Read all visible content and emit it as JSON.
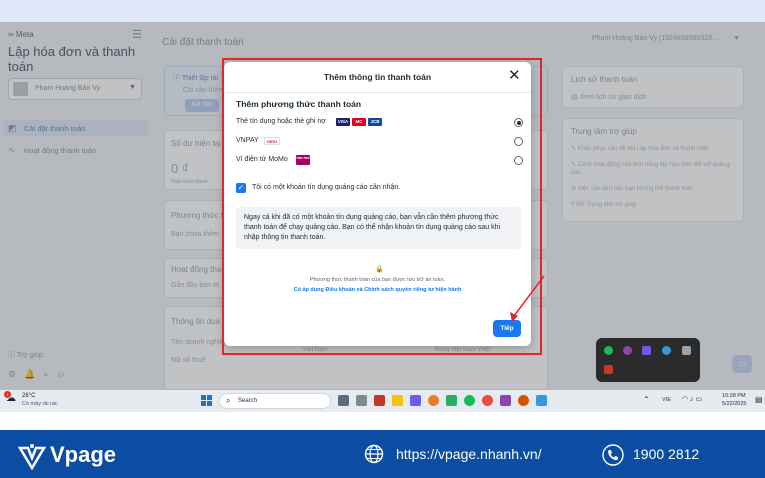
{
  "app": {
    "brand": "∞ Meta",
    "title": "Lập hóa đơn và thanh toán",
    "account_name": "Phạm Hoàng Bảo Vy",
    "nav": [
      {
        "label": "Cài đặt thanh toán",
        "icon": "card-icon"
      },
      {
        "label": "Hoạt động thanh toán",
        "icon": "activity-icon"
      }
    ],
    "help": "Trợ giúp"
  },
  "main": {
    "page_title": "Cài đặt thanh toán",
    "user_selector": "Phạm Hoàng Bảo Vy (1924839588323...",
    "notice_title": "Thiết lập tài",
    "notice_sub": "Chỉ cần thêm",
    "notice_btn": "Bắt đầu",
    "balance_label": "Số dư hiện tại",
    "balance_value": "0 ₫",
    "balance_sub": "Phải chưa thanh",
    "payment_methods_label": "Phương thức t",
    "payment_methods_sub": "Bạn chưa thêm",
    "activity_label": "Hoạt động tha",
    "activity_sub": "Gần đây bạn M",
    "business_label": "Thông tin doa",
    "business_name_label": "Tên doanh nghiệp",
    "tax_label": "Mã số thuế",
    "country": "Việt Nam",
    "currency": "Đồng Việt Nam VNĐ",
    "history_title": "Lịch sử thanh toán",
    "history_link": "Xem lịch sử giao dịch",
    "help_center_title": "Trung tâm trợ giúp",
    "help_links": [
      "Khắc phục vấn đề khi Lập hóa đơn và thanh toán",
      "Cách hoạt động của tính năng lập hóa đơn đối với quảng cáo",
      "Việc cần làm nếu bạn không thể thanh toán",
      "Mở Trung tâm trợ giúp"
    ]
  },
  "modal": {
    "title": "Thêm thông tin thanh toán",
    "section_title": "Thêm phương thức thanh toán",
    "options": [
      {
        "label": "Thẻ tín dụng hoặc thẻ ghi nợ",
        "selected": true
      },
      {
        "label": "VNPAY",
        "selected": false
      },
      {
        "label": "Ví điện tử MoMo",
        "selected": false
      }
    ],
    "card_logos": [
      "VISA",
      "MC",
      "JCB"
    ],
    "vnpay_logo": "VNPAY",
    "momo_logo": "mo mo",
    "checkbox_label": "Tôi có một khoản tín dụng quảng cáo cần nhận.",
    "checkbox_checked": true,
    "info_text": "Ngay cả khi đã có một khoản tín dụng quảng cáo, bạn vẫn cần thêm phương thức thanh toán để chạy quảng cáo. Bạn có thể nhận khoản tín dụng quảng cáo sau khi nhập thông tin thanh toán.",
    "secure_text": "Phương thức thanh toán của bạn được lưu trữ an toàn.",
    "terms_text": "Có áp dụng Điều khoản và Chính sách quyền riêng tư hiện hành",
    "next_button": "Tiếp"
  },
  "taskbar": {
    "weather_temp": "28°C",
    "weather_desc": "Có mây rải rác",
    "weather_badge": "1",
    "search_placeholder": "Search",
    "lang": "VIE",
    "time": "10:28 PM",
    "date": "5/22/2025"
  },
  "footer": {
    "brand": "Vpage",
    "url": "https://vpage.nhanh.vn/",
    "phone": "1900 2812"
  },
  "colors": {
    "accent": "#1877f2",
    "footer_bg": "#0b4da2",
    "highlight": "#e0282a"
  }
}
